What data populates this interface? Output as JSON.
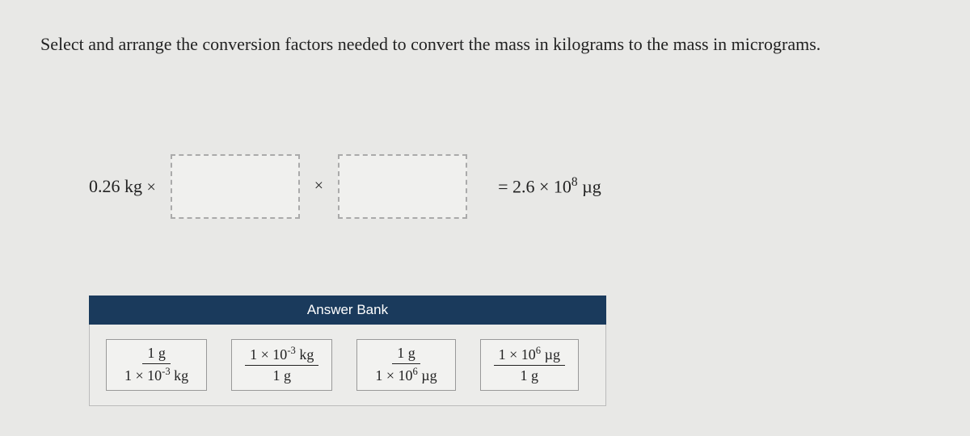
{
  "question": "Select and arrange the conversion factors needed to convert the mass in kilograms to the mass in micrograms.",
  "equation": {
    "start_value": "0.26 kg",
    "times": "×",
    "equals": "=",
    "result_html": "2.6 × 10⁸ µg"
  },
  "answer_bank": {
    "title": "Answer Bank",
    "tiles": [
      {
        "num": "1 g",
        "den": "1 × 10⁻³ kg"
      },
      {
        "num": "1 × 10⁻³ kg",
        "den": "1 g"
      },
      {
        "num": "1 g",
        "den": "1 × 10⁶ µg"
      },
      {
        "num": "1 × 10⁶ µg",
        "den": "1 g"
      }
    ]
  }
}
